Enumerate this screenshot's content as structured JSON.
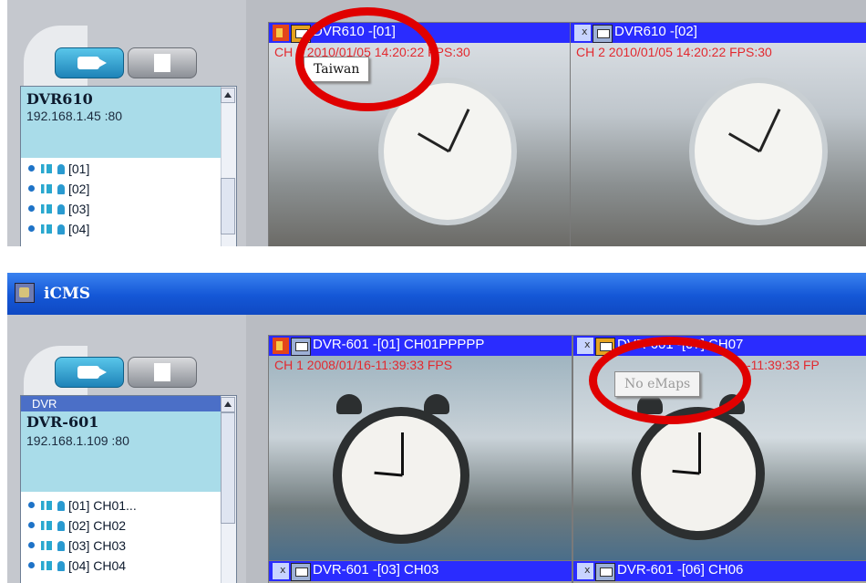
{
  "top": {
    "device": {
      "name": "DVR610",
      "ip": "192.168.1.45 :80"
    },
    "channels": [
      "[01]",
      "[02]",
      "[03]",
      "[04]"
    ],
    "tiles": [
      {
        "label": "DVR610 -[01]",
        "osd": "CH 1 2010/01/05 14:20:22 FPS:30",
        "audio": "on",
        "map_icon": "highlighted"
      },
      {
        "label": "DVR610 -[02]",
        "osd": "CH 2 2010/01/05 14:20:22 FPS:30",
        "audio": "muted",
        "map_icon": "normal"
      }
    ],
    "popup": "Taiwan"
  },
  "bottom": {
    "app_title": "iCMS",
    "device": {
      "group": "DVR",
      "name": "DVR-601",
      "ip": "192.168.1.109 :80"
    },
    "channels": [
      "[01] CH01...",
      "[02] CH02",
      "[03] CH03",
      "[04] CH04"
    ],
    "tiles": [
      {
        "label": "DVR-601 -[01] CH01PPPPP",
        "osd": "CH 1 2008/01/16-11:39:33 FPS",
        "audio": "on",
        "map_icon": "normal"
      },
      {
        "label": "DVR-601 -[07] CH07",
        "osd": "-11:39:33 FP",
        "audio": "muted",
        "map_icon": "highlighted"
      },
      {
        "label": "DVR-601 -[03] CH03",
        "audio": "muted",
        "map_icon": "normal"
      },
      {
        "label": "DVR-601 -[06] CH06",
        "audio": "muted",
        "map_icon": "normal"
      }
    ],
    "popup": "No eMaps"
  },
  "colors": {
    "highlight_ring": "#e00000",
    "tile_title_bar": "#2a2cff",
    "osd_text": "#e2292f",
    "titlebar": "#1457d6"
  }
}
